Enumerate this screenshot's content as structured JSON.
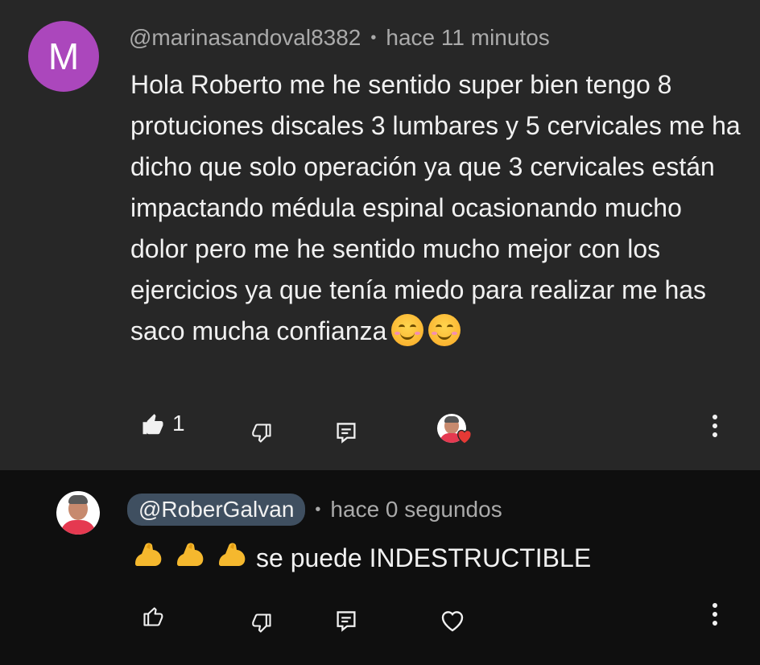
{
  "comments": [
    {
      "avatar_letter": "M",
      "author": "@marinasandoval8382",
      "time": "hace 11 minutos",
      "text": "Hola Roberto me he sentido super bien tengo 8 protuciones discales 3 lumbares y 5 cervicales me ha dicho que solo operación ya que 3 cervicales están impactando médula espinal ocasionando mucho dolor pero me he sentido mucho mejor con los ejercicios ya que tenía miedo para realizar me has saco mucha confianza",
      "like_count": "1"
    },
    {
      "author": "@RoberGalvan",
      "time": "hace 0 segundos",
      "text": "se puede INDESTRUCTIBLE"
    }
  ],
  "colors": {
    "avatar_purple": "#ab47bc",
    "heart_red": "#e53935",
    "chip_bg": "#3f4f60"
  },
  "icons": [
    "thumbs-up-filled-icon",
    "thumbs-down-icon",
    "reply-icon",
    "creator-heart-icon",
    "more-vert-icon",
    "thumbs-up-outline-icon",
    "heart-outline-icon",
    "flexed-biceps-emoji",
    "smiling-face-emoji"
  ]
}
